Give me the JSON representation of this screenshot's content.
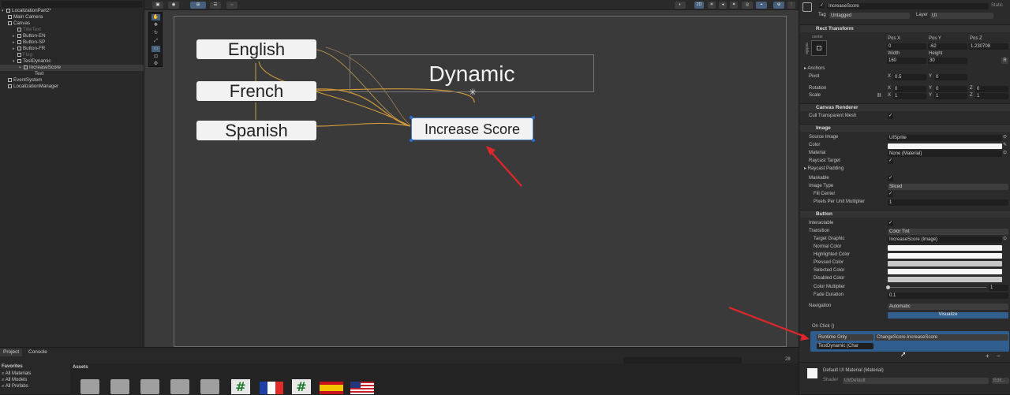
{
  "hierarchy": {
    "items": [
      {
        "label": "LocalizationPart2*",
        "depth": 0
      },
      {
        "label": "Main Camera",
        "depth": 1
      },
      {
        "label": "Canvas",
        "depth": 1
      },
      {
        "label": "TitleText",
        "depth": 2
      },
      {
        "label": "Button-EN",
        "depth": 2
      },
      {
        "label": "Button-SP",
        "depth": 2
      },
      {
        "label": "Button-FR",
        "depth": 2
      },
      {
        "label": "Flag",
        "depth": 2
      },
      {
        "label": "TestDynamic",
        "depth": 2
      },
      {
        "label": "IncreaseScore",
        "depth": 3
      },
      {
        "label": "Text",
        "depth": 4
      },
      {
        "label": "EventSystem",
        "depth": 1
      },
      {
        "label": "LocalizationManager",
        "depth": 1
      }
    ]
  },
  "scene": {
    "toolbar_2d": "2D",
    "buttons": {
      "english": "English",
      "french": "French",
      "spanish": "Spanish",
      "increase": "Increase Score"
    },
    "dynamic_text": "Dynamic"
  },
  "project": {
    "tabs": [
      "Project",
      "Console"
    ],
    "favorites_title": "Favorites",
    "favorites": [
      "All Materials",
      "All Models",
      "All Prefabs"
    ],
    "assets_title": "Assets",
    "count": "28"
  },
  "inspector": {
    "object_name": "IncreaseScore",
    "static_label": "Static",
    "tag_label": "Tag",
    "tag_value": "Untagged",
    "layer_label": "Layer",
    "layer_value": "UI",
    "rect": {
      "title": "Rect Transform",
      "anchor_preset": "center",
      "side_label": "middle",
      "posx_label": "Pos X",
      "posy_label": "Pos Y",
      "posz_label": "Pos Z",
      "posx": "0",
      "posy": "-62",
      "posz": "1.230708",
      "width_label": "Width",
      "height_label": "Height",
      "width": "160",
      "height": "30",
      "anchors_label": "Anchors",
      "pivot_label": "Pivot",
      "pivot_x": "0.5",
      "pivot_y": "0",
      "rotation_label": "Rotation",
      "rot_x": "0",
      "rot_y": "0",
      "rot_z": "0",
      "scale_label": "Scale",
      "scale_x": "1",
      "scale_y": "1",
      "scale_z": "1"
    },
    "canvas_renderer": {
      "title": "Canvas Renderer",
      "cull_label": "Cull Transparent Mesh"
    },
    "image": {
      "title": "Image",
      "source_label": "Source Image",
      "source_value": "UISprite",
      "color_label": "Color",
      "material_label": "Material",
      "material_value": "None (Material)",
      "raycast_label": "Raycast Target",
      "padding_label": "Raycast Padding",
      "maskable_label": "Maskable",
      "type_label": "Image Type",
      "type_value": "Sliced",
      "fill_label": "Fill Center",
      "ppu_label": "Pixels Per Unit Multiplier",
      "ppu_value": "1"
    },
    "button": {
      "title": "Button",
      "interactable_label": "Interactable",
      "transition_label": "Transition",
      "transition_value": "Color Tint",
      "target_label": "Target Graphic",
      "target_value": "IncreaseScore (Image)",
      "normal_label": "Normal Color",
      "highlighted_label": "Highlighted Color",
      "pressed_label": "Pressed Color",
      "selected_label": "Selected Color",
      "disabled_label": "Disabled Color",
      "multiplier_label": "Color Multiplier",
      "multiplier_value": "1",
      "fade_label": "Fade Duration",
      "fade_value": "0.1",
      "navigation_label": "Navigation",
      "navigation_value": "Automatic",
      "visualize_label": "Visualize",
      "onclick_label": "On Click ()",
      "runtime_value": "Runtime Only",
      "function_value": "ChangeScore.IncreaseScore",
      "object_value": "TestDynamic (Char",
      "plus": "+",
      "minus": "−"
    },
    "material": {
      "name": "Default UI Material (Material)",
      "shader_label": "Shader",
      "shader_value": "UI/Default",
      "edit_label": "Edit..."
    }
  },
  "colors": {
    "accent": "#46607c",
    "selection": "#2c6ed6",
    "annotation_arrow": "#e0262b",
    "wire": "#c8a050"
  }
}
